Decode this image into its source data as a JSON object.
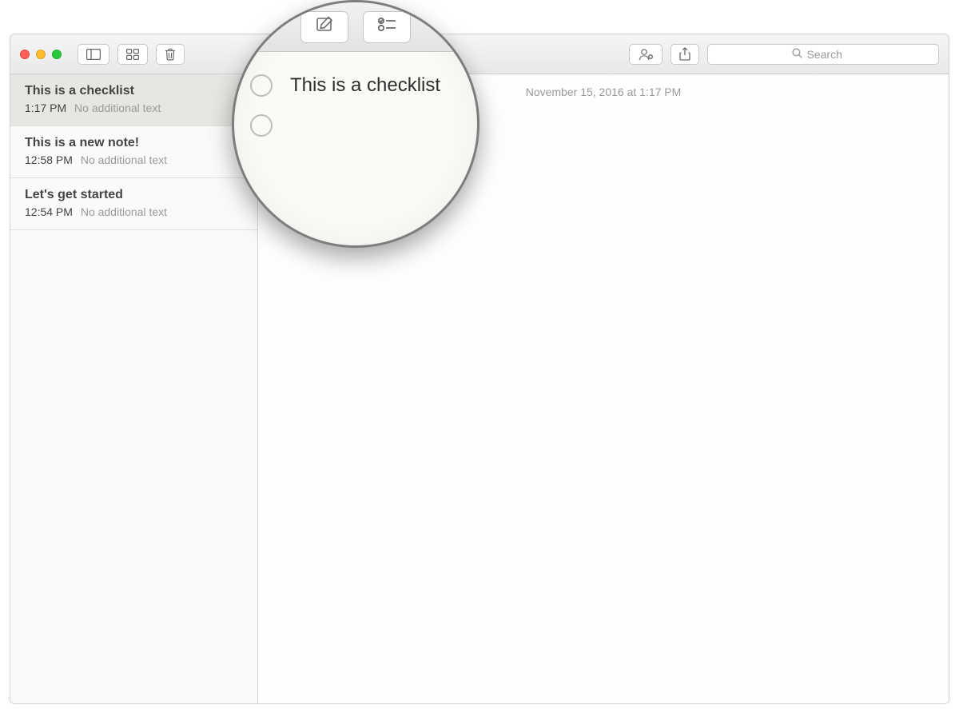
{
  "search": {
    "placeholder": "Search"
  },
  "sidebar": {
    "items": [
      {
        "title": "This is a checklist",
        "time": "1:17 PM",
        "snippet": "No additional text",
        "selected": true
      },
      {
        "title": "This is a new note!",
        "time": "12:58 PM",
        "snippet": "No additional text",
        "selected": false
      },
      {
        "title": "Let's get started",
        "time": "12:54 PM",
        "snippet": "No additional text",
        "selected": false
      }
    ]
  },
  "editor": {
    "date": "November 15, 2016 at 1:17 PM"
  },
  "loupe": {
    "checklist_line1": "This is a checklist"
  }
}
